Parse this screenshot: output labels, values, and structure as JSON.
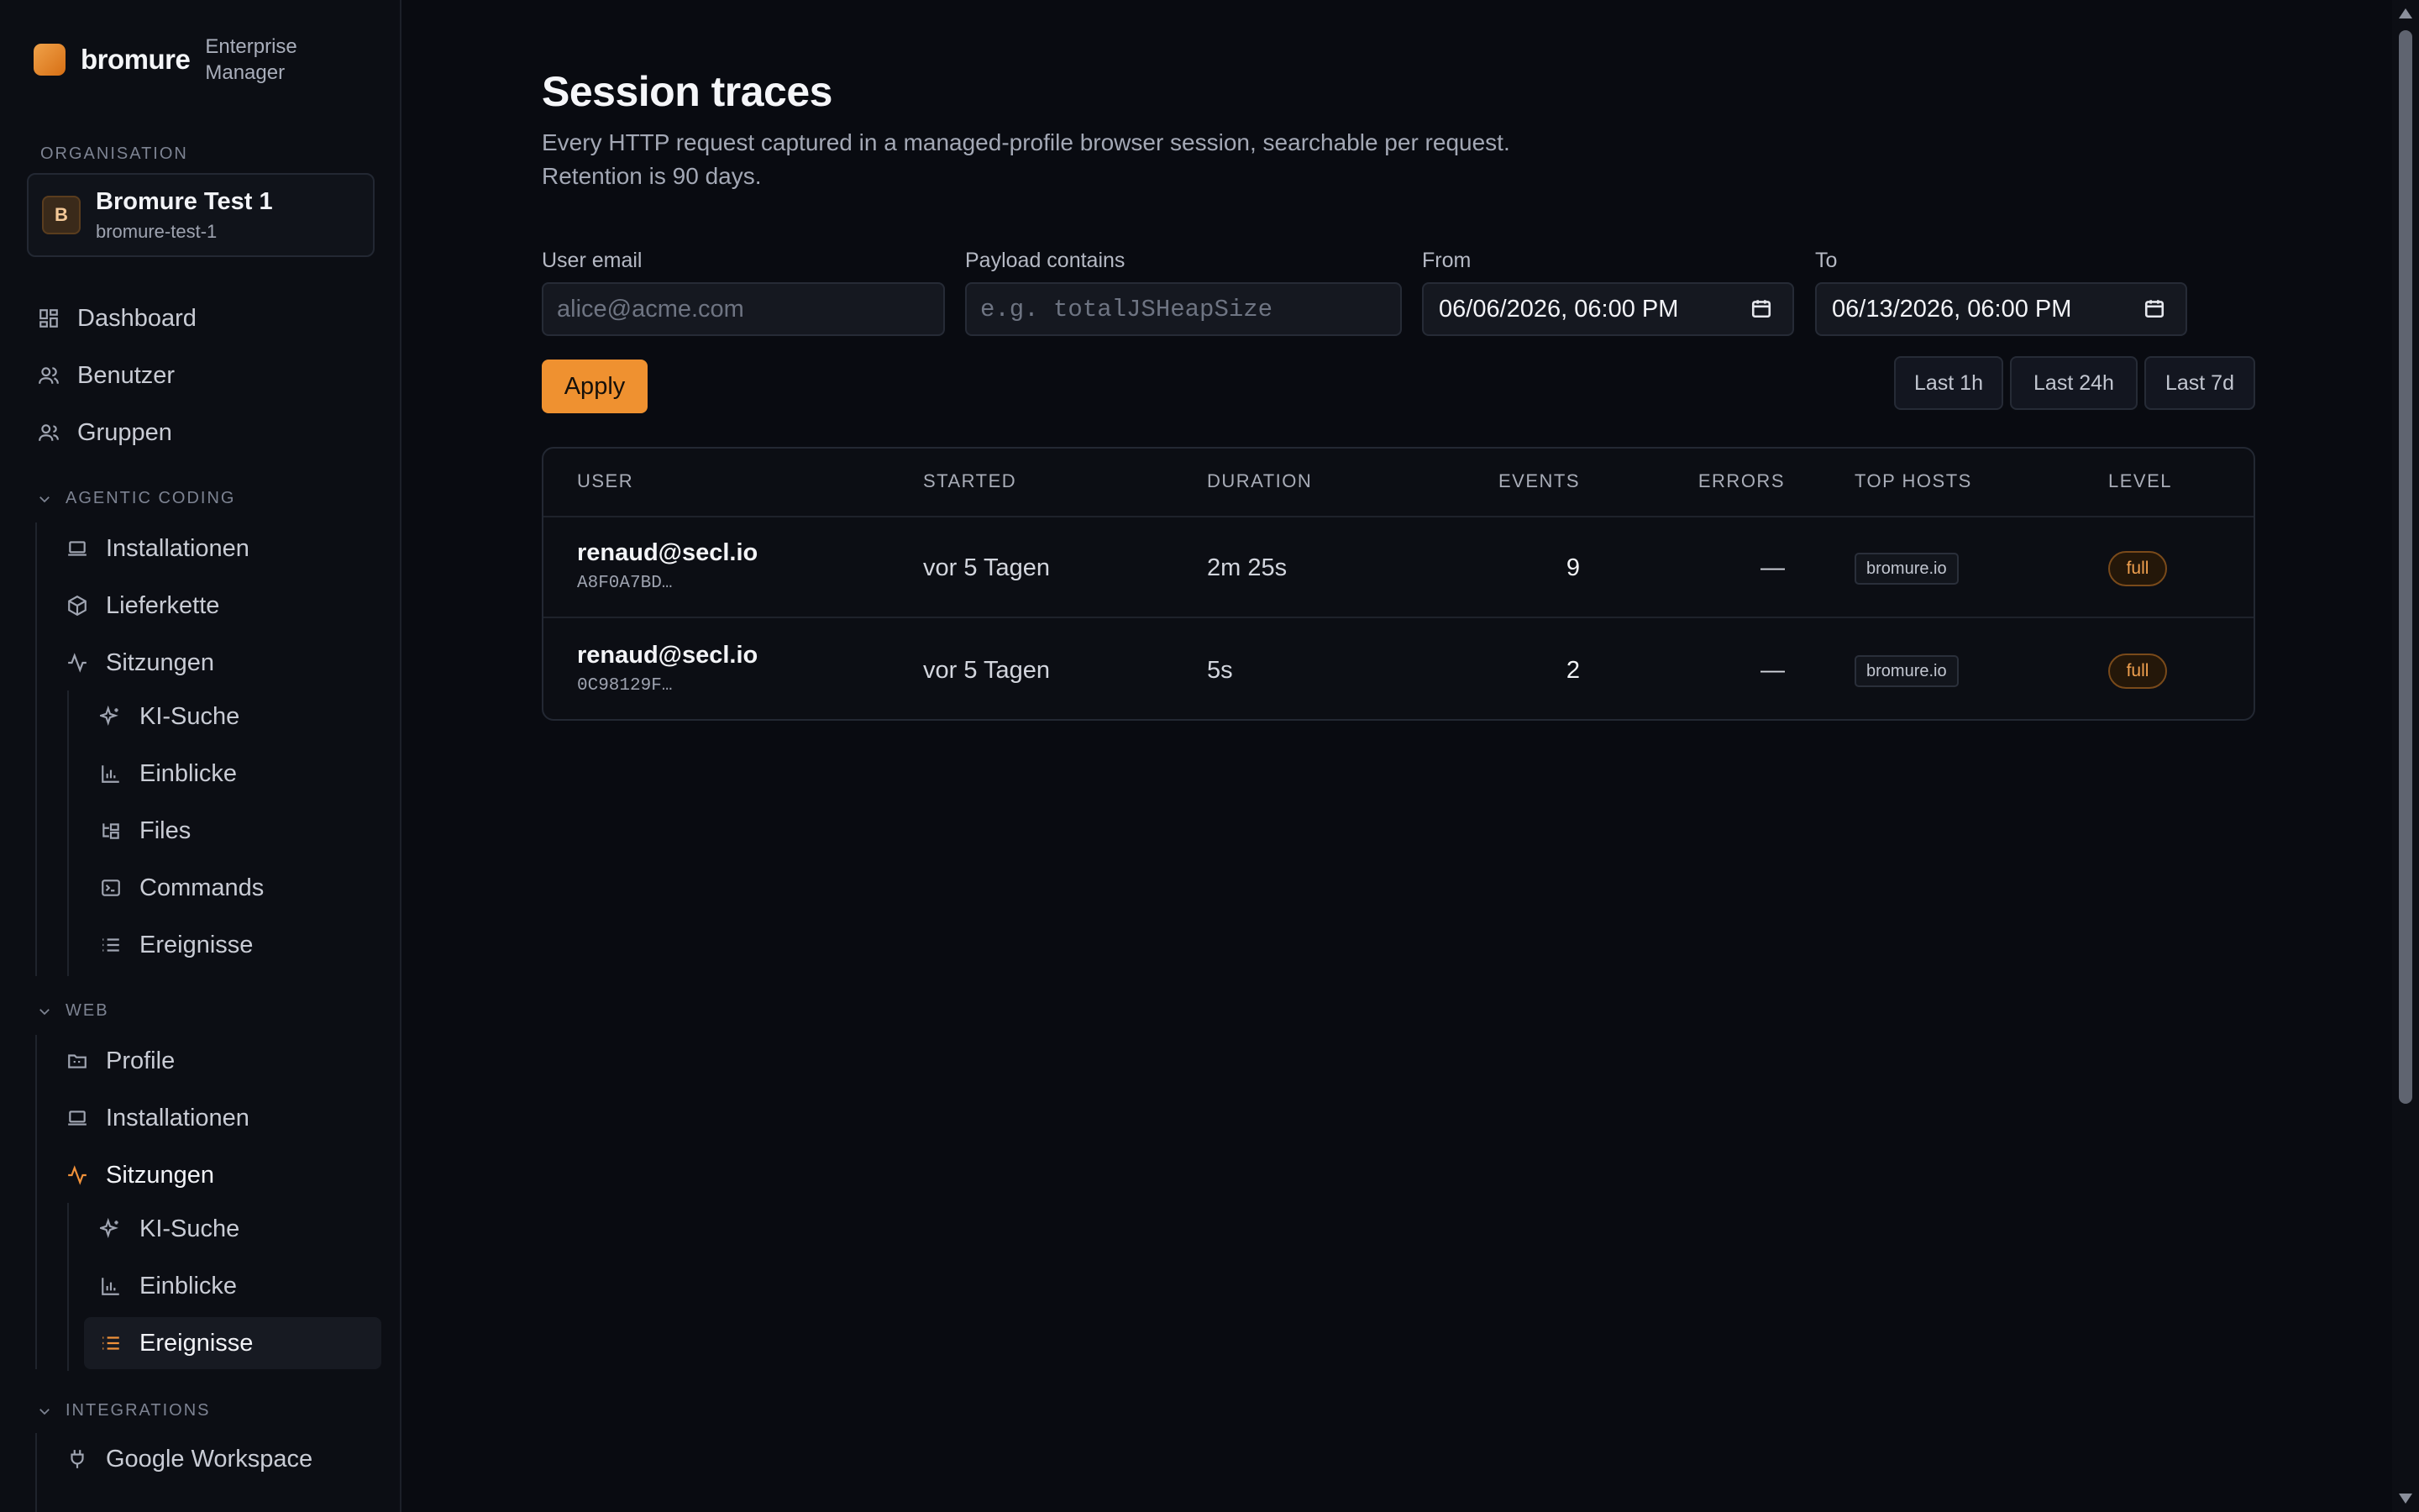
{
  "brand": {
    "name": "bromure",
    "subtitle": "Enterprise Manager"
  },
  "sidebar": {
    "org_label": "ORGANISATION",
    "org": {
      "avatar": "B",
      "name": "Bromure Test 1",
      "slug": "bromure-test-1"
    },
    "top_items": [
      {
        "label": "Dashboard",
        "icon": "dashboard-icon"
      },
      {
        "label": "Benutzer",
        "icon": "users-icon"
      },
      {
        "label": "Gruppen",
        "icon": "group-icon"
      }
    ],
    "agentic": {
      "title": "AGENTIC CODING",
      "items": [
        {
          "label": "Installationen",
          "icon": "laptop-icon"
        },
        {
          "label": "Lieferkette",
          "icon": "package-icon"
        },
        {
          "label": "Sitzungen",
          "icon": "activity-icon"
        }
      ],
      "sub_items": [
        {
          "label": "KI-Suche",
          "icon": "sparkle-icon"
        },
        {
          "label": "Einblicke",
          "icon": "bar-chart-icon"
        },
        {
          "label": "Files",
          "icon": "file-tree-icon"
        },
        {
          "label": "Commands",
          "icon": "terminal-icon"
        },
        {
          "label": "Ereignisse",
          "icon": "list-icon"
        }
      ]
    },
    "web": {
      "title": "WEB",
      "items": [
        {
          "label": "Profile",
          "icon": "folder-icon"
        },
        {
          "label": "Installationen",
          "icon": "laptop-icon"
        },
        {
          "label": "Sitzungen",
          "icon": "activity-icon"
        }
      ],
      "sub_items": [
        {
          "label": "KI-Suche",
          "icon": "sparkle-icon"
        },
        {
          "label": "Einblicke",
          "icon": "bar-chart-icon"
        },
        {
          "label": "Ereignisse",
          "icon": "list-icon"
        }
      ]
    },
    "integrations": {
      "title": "INTEGRATIONS",
      "items": [
        {
          "label": "Google Workspace",
          "icon": "plug-icon"
        }
      ]
    }
  },
  "main": {
    "title": "Session traces",
    "description": "Every HTTP request captured in a managed-profile browser session, searchable per request. Retention is 90 days.",
    "filters": {
      "email_label": "User email",
      "email_placeholder": "alice@acme.com",
      "payload_label": "Payload contains",
      "payload_placeholder": "e.g. totalJSHeapSize",
      "from_label": "From",
      "from_value": "06/06/2026, 06:00 PM",
      "to_label": "To",
      "to_value": "06/13/2026, 06:00 PM"
    },
    "apply_label": "Apply",
    "ranges": [
      "Last 1h",
      "Last 24h",
      "Last 7d"
    ],
    "table": {
      "headers": [
        "USER",
        "STARTED",
        "DURATION",
        "EVENTS",
        "ERRORS",
        "TOP HOSTS",
        "LEVEL"
      ],
      "rows": [
        {
          "email": "renaud@secl.io",
          "id": "A8F0A7BD…",
          "started": "vor 5 Tagen",
          "duration": "2m 25s",
          "events": "9",
          "errors": "—",
          "host": "bromure.io",
          "level": "full"
        },
        {
          "email": "renaud@secl.io",
          "id": "0C98129F…",
          "started": "vor 5 Tagen",
          "duration": "5s",
          "events": "2",
          "errors": "—",
          "host": "bromure.io",
          "level": "full"
        }
      ]
    }
  },
  "colors": {
    "accent": "#ef9130",
    "background": "#090b11",
    "sidebar": "#0c0e14"
  }
}
